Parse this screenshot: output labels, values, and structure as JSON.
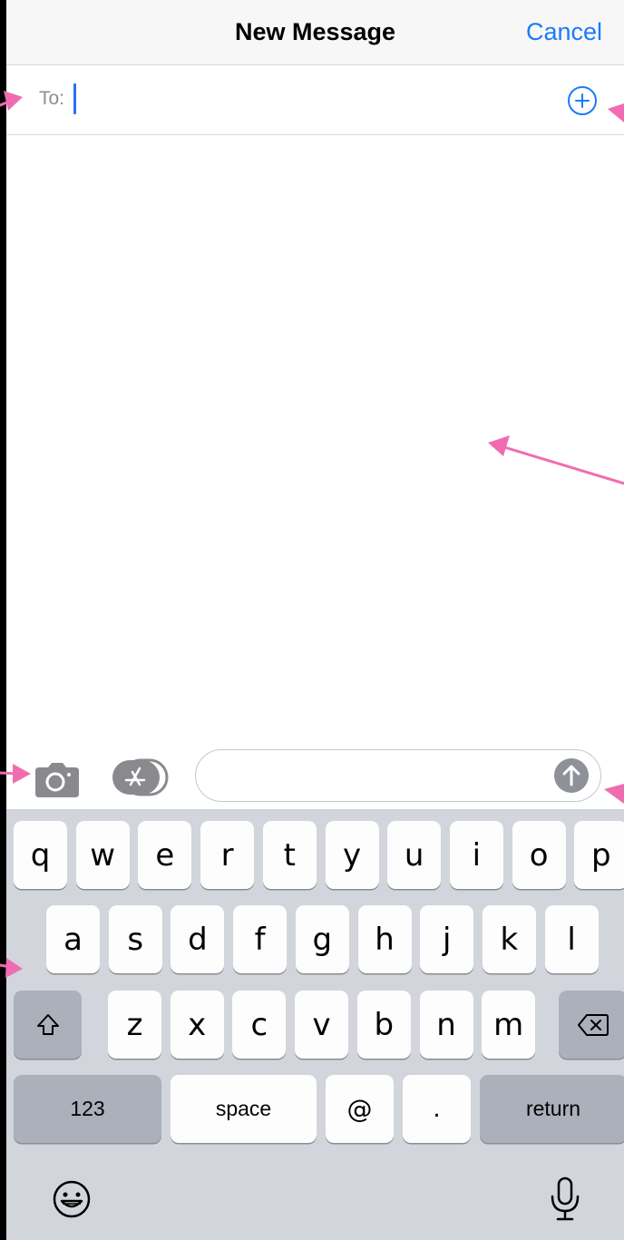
{
  "nav": {
    "title": "New Message",
    "cancel_label": "Cancel"
  },
  "recipient": {
    "to_label": "To:",
    "value": ""
  },
  "compose": {
    "placeholder": ""
  },
  "keyboard": {
    "row1": [
      "q",
      "w",
      "e",
      "r",
      "t",
      "y",
      "u",
      "i",
      "o",
      "p"
    ],
    "row2": [
      "a",
      "s",
      "d",
      "f",
      "g",
      "h",
      "j",
      "k",
      "l"
    ],
    "row3": [
      "z",
      "x",
      "c",
      "v",
      "b",
      "n",
      "m"
    ],
    "numbers_label": "123",
    "space_label": "space",
    "at_label": "@",
    "period_label": ".",
    "return_label": "return"
  },
  "colors": {
    "accent": "#1a7cf5",
    "annotation": "#f06cb0",
    "keyboard_bg": "#d2d5db",
    "function_key": "#abb0ba"
  },
  "icons": [
    "add-contact-icon",
    "camera-icon",
    "app-store-icon",
    "send-arrow-icon",
    "shift-icon",
    "backspace-icon",
    "emoji-icon",
    "microphone-icon"
  ]
}
